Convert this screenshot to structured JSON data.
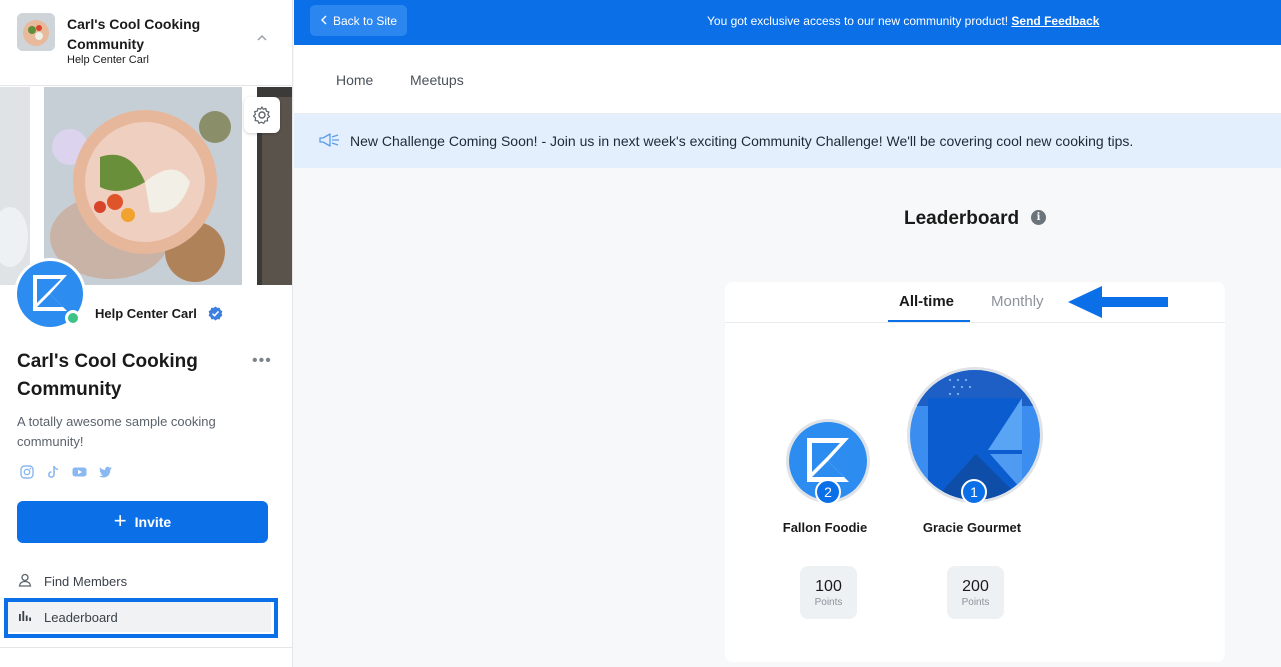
{
  "sidebar": {
    "community_title": "Carl's Cool Cooking Community",
    "owner_short": "Help Center Carl",
    "owner_name": "Help Center Carl",
    "community_name": "Carl's Cool Cooking Community",
    "description": "A totally awesome sample cooking community!",
    "socials": [
      "instagram-icon",
      "tiktok-icon",
      "youtube-icon",
      "twitter-icon"
    ],
    "invite_label": "Invite",
    "nav": [
      {
        "label": "Find Members",
        "icon": "person-icon"
      },
      {
        "label": "Leaderboard",
        "icon": "bar-chart-icon",
        "active": true
      }
    ]
  },
  "topbar": {
    "back_label": "Back to Site",
    "message": "You got exclusive access to our new community product!",
    "feedback_link": "Send Feedback"
  },
  "tabs": [
    "Home",
    "Meetups"
  ],
  "announcement": "New Challenge Coming Soon! - Join us in next week's exciting Community Challenge! We'll be covering cool new cooking tips.",
  "leaderboard": {
    "title": "Leaderboard",
    "tabs": [
      "All-time",
      "Monthly"
    ],
    "active_tab": "All-time",
    "entries": [
      {
        "rank": "1",
        "name": "Gracie Gourmet",
        "points": "200",
        "points_label": "Points"
      },
      {
        "rank": "2",
        "name": "Fallon Foodie",
        "points": "100",
        "points_label": "Points"
      }
    ]
  },
  "colors": {
    "brand_blue": "#0b6fe8",
    "announce_bg": "#e3effc",
    "online_green": "#3ec285",
    "annotation_blue": "#0b6fe8"
  }
}
